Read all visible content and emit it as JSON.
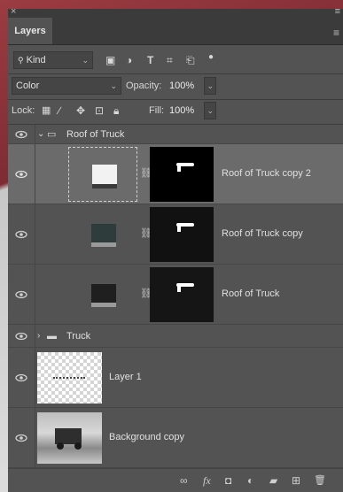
{
  "panel": {
    "close_glyph": "×",
    "grip_glyph": "≡",
    "tab_label": "Layers",
    "menu_glyph": "≡"
  },
  "filter": {
    "kind_label": "Kind",
    "search_glyph": "🔍",
    "chev": "⌄",
    "icons": [
      "image-filter-icon",
      "adjustment-filter-icon",
      "type-filter-icon",
      "shape-filter-icon",
      "smart-object-filter-icon",
      "filter-toggle-icon"
    ]
  },
  "blend": {
    "mode": "Color",
    "opacity_label": "Opacity:",
    "opacity_value": "100%"
  },
  "lock": {
    "label": "Lock:",
    "fill_label": "Fill:",
    "fill_value": "100%"
  },
  "layers": [
    {
      "name": "Roof of Truck",
      "type": "group",
      "expanded": true
    },
    {
      "name": "Roof of Truck copy 2",
      "type": "masked",
      "selected": true
    },
    {
      "name": "Roof of Truck copy",
      "type": "masked"
    },
    {
      "name": "Roof of Truck",
      "type": "masked"
    },
    {
      "name": "Truck",
      "type": "group",
      "expanded": false
    },
    {
      "name": "Layer 1",
      "type": "pixel"
    },
    {
      "name": "Background copy",
      "type": "pixel"
    }
  ],
  "bottom_bar": {
    "link_glyph": "∞",
    "fx_label": "fx",
    "mask_glyph": "◘",
    "adjust_glyph": "◐",
    "folder_glyph": "▰",
    "new_glyph": "⊞",
    "trash_glyph": "🗑"
  },
  "colors": {
    "panel_bg": "#535353",
    "selected_row": "#6b6b6b",
    "dark_bar": "#3b3b3b"
  }
}
